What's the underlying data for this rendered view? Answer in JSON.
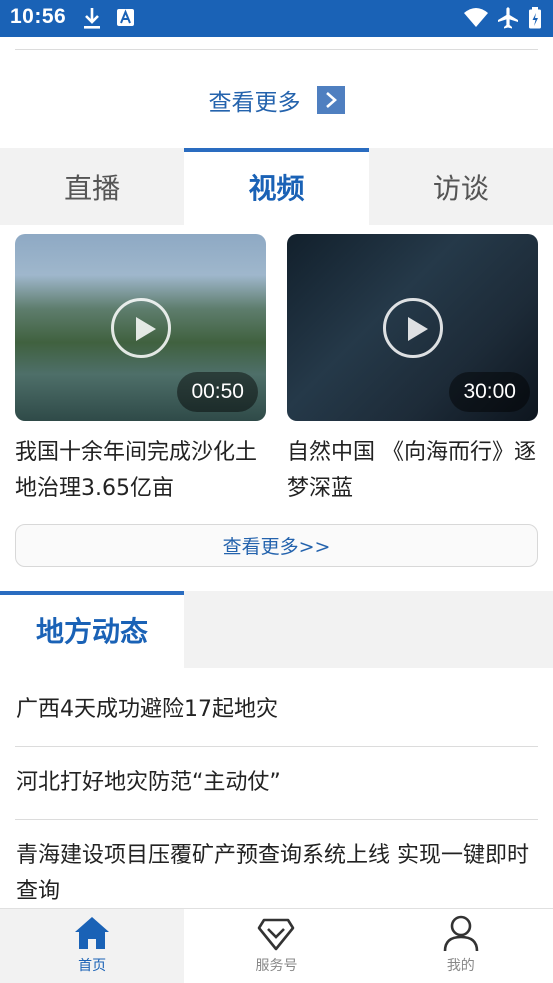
{
  "status_bar": {
    "time": "10:56",
    "icons": [
      "download-icon",
      "app-notification-icon",
      "wifi-icon",
      "airplane-icon",
      "battery-icon"
    ]
  },
  "see_more_top": {
    "label": "查看更多"
  },
  "tabs": [
    {
      "label": "直播",
      "active": false
    },
    {
      "label": "视频",
      "active": true
    },
    {
      "label": "访谈",
      "active": false
    }
  ],
  "videos": [
    {
      "duration": "00:50",
      "title": "我国十余年间完成沙化土地治理3.65亿亩"
    },
    {
      "duration": "30:00",
      "title": "自然中国 《向海而行》逐梦深蓝"
    }
  ],
  "see_more_videos": {
    "label": "查看更多>>"
  },
  "section": {
    "title": "地方动态"
  },
  "news": [
    "广西4天成功避险17起地灾",
    "河北打好地灾防范“主动仗”",
    "青海建设项目压覆矿产预查询系统上线 实现一键即时查询"
  ],
  "bottom_nav": [
    {
      "label": "首页",
      "icon": "home-icon",
      "active": true
    },
    {
      "label": "服务号",
      "icon": "service-diamond-icon",
      "active": false
    },
    {
      "label": "我的",
      "icon": "user-icon",
      "active": false
    }
  ],
  "colors": {
    "brand_blue": "#1a62b6",
    "tab_bg": "#f2f2f2",
    "link_blue": "#2463ad"
  }
}
